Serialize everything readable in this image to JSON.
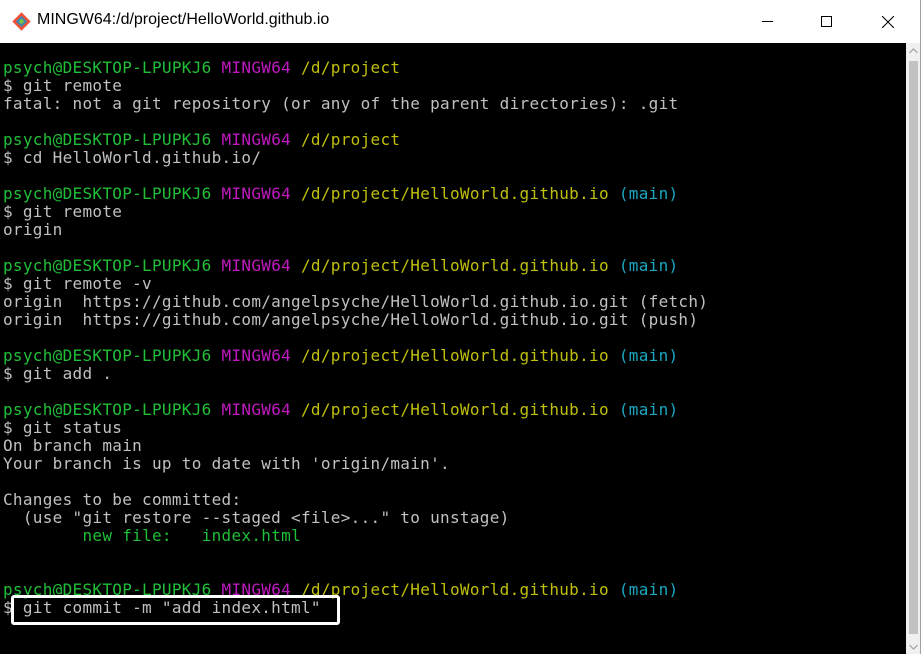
{
  "window": {
    "title": "MINGW64:/d/project/HelloWorld.github.io",
    "icon": "git-bash-icon",
    "controls": [
      "minimize-icon",
      "maximize-icon",
      "close-icon"
    ]
  },
  "colors": {
    "user": "#1fbf38",
    "msystem": "#bf19bf",
    "path": "#bfbf0c",
    "branch": "#19a8bf",
    "output": "#c0c0c0",
    "background": "#000000"
  },
  "terminal": {
    "prompt_user": "psych@DESKTOP-LPUPKJ6",
    "prompt_msys": "MINGW64",
    "blocks": [
      {
        "path": "/d/project",
        "branch": "",
        "command": "$ git remote",
        "output": [
          "fatal: not a git repository (or any of the parent directories): .git"
        ]
      },
      {
        "path": "/d/project",
        "branch": "",
        "command": "$ cd HelloWorld.github.io/",
        "output": []
      },
      {
        "path": "/d/project/HelloWorld.github.io",
        "branch": "(main)",
        "command": "$ git remote",
        "output": [
          "origin"
        ]
      },
      {
        "path": "/d/project/HelloWorld.github.io",
        "branch": "(main)",
        "command": "$ git remote -v",
        "output": [
          "origin  https://github.com/angelpsyche/HelloWorld.github.io.git (fetch)",
          "origin  https://github.com/angelpsyche/HelloWorld.github.io.git (push)"
        ]
      },
      {
        "path": "/d/project/HelloWorld.github.io",
        "branch": "(main)",
        "command": "$ git add .",
        "output": []
      },
      {
        "path": "/d/project/HelloWorld.github.io",
        "branch": "(main)",
        "command": "$ git status",
        "output": [
          "On branch main",
          "Your branch is up to date with 'origin/main'.",
          "",
          "Changes to be committed:",
          "  (use \"git restore --staged <file>...\" to unstage)"
        ],
        "staged": {
          "label": "new file:",
          "file": "index.html"
        }
      },
      {
        "path": "/d/project/HelloWorld.github.io",
        "branch": "(main)",
        "command": "$ git commit -m \"add index.html\"",
        "output": [],
        "highlighted": true
      }
    ]
  }
}
